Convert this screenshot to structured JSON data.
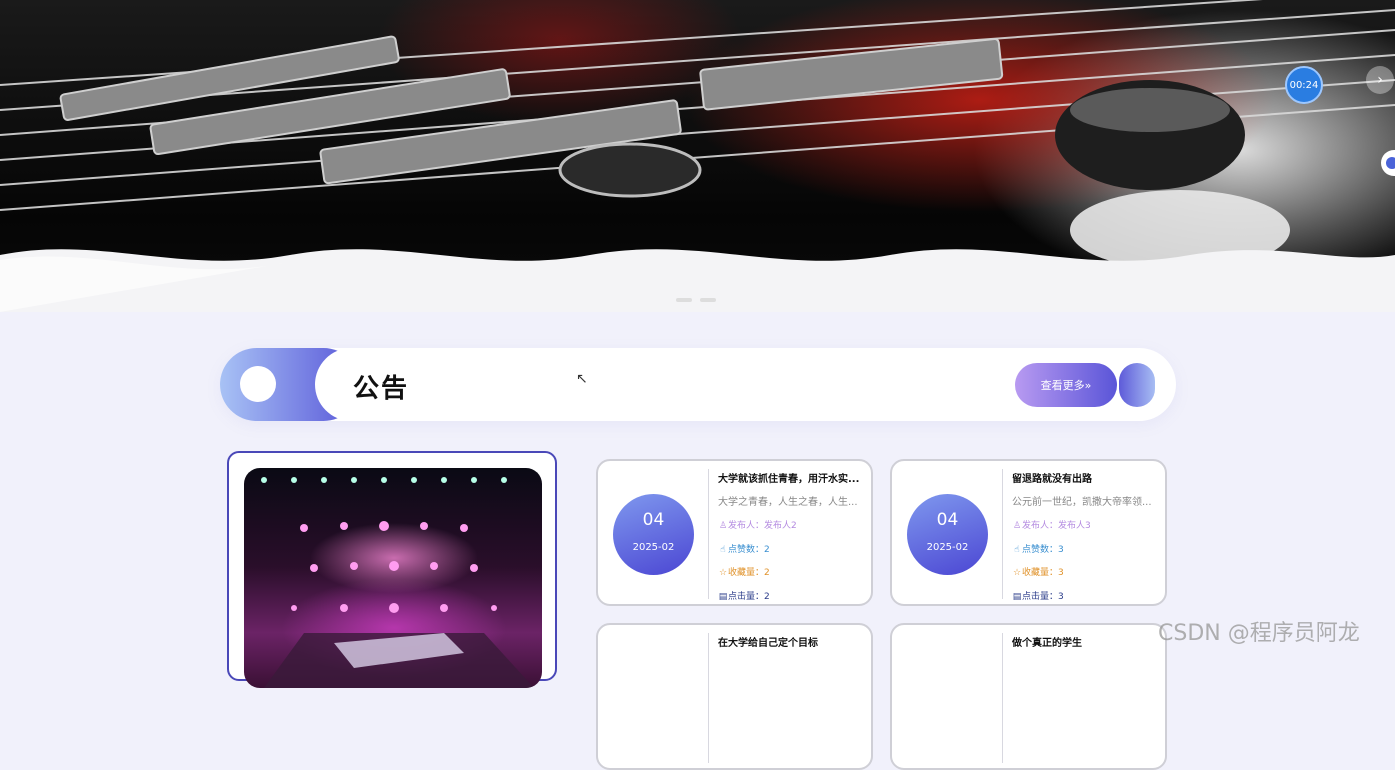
{
  "hero": {
    "timer": "00:24",
    "next_icon": "›"
  },
  "section": {
    "title": "公告",
    "more_label": "查看更多»"
  },
  "notices": [
    {
      "day": "04",
      "year_month": "2025-02",
      "title": "大学就该抓住青春，用汗水实...",
      "summary": "大学之青春，人生之春，人生...",
      "publisher": "发布人：发布人2",
      "likes": "点赞数：2",
      "favorites": "收藏量：2",
      "clicks": "点击量：2"
    },
    {
      "day": "04",
      "year_month": "2025-02",
      "title": "留退路就没有出路",
      "summary": "公元前一世纪，凯撒大帝率领...",
      "publisher": "发布人：发布人3",
      "likes": "点赞数：3",
      "favorites": "收藏量：3",
      "clicks": "点击量：3"
    },
    {
      "title": "在大学给自己定个目标"
    },
    {
      "title": "做个真正的学生"
    }
  ],
  "watermark": "CSDN @程序员阿龙",
  "colors": {
    "accent": "#5a55d8",
    "accent_light": "#a8c2f5",
    "publisher": "#b48be0",
    "likes": "#3a8fd0",
    "favorites": "#e0922a",
    "clicks": "#2b3c8a"
  }
}
